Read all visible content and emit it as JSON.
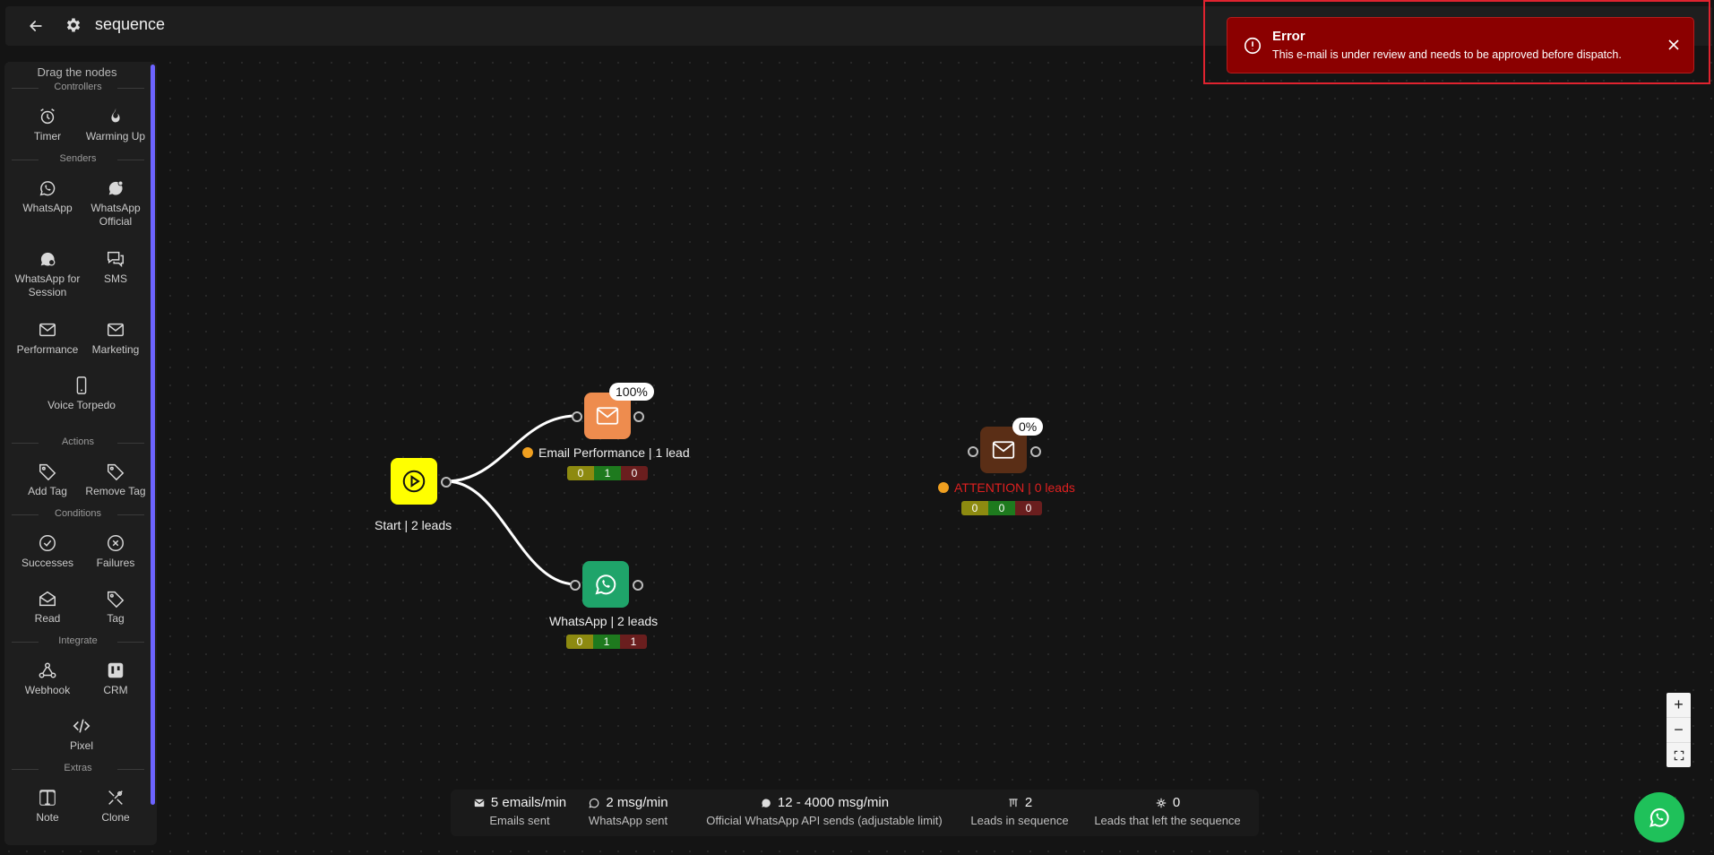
{
  "header": {
    "title": "sequence"
  },
  "sidebar": {
    "hint": "Drag the nodes",
    "sections": {
      "controllers": "Controllers",
      "senders": "Senders",
      "actions": "Actions",
      "conditions": "Conditions",
      "integrate": "Integrate",
      "extras": "Extras"
    },
    "tools": {
      "timer": "Timer",
      "warming_up": "Warming Up",
      "whatsapp": "WhatsApp",
      "whatsapp_official": "WhatsApp Official",
      "whatsapp_session": "WhatsApp for Session",
      "sms": "SMS",
      "performance": "Performance",
      "marketing": "Marketing",
      "voice_torpedo": "Voice Torpedo",
      "add_tag": "Add Tag",
      "remove_tag": "Remove Tag",
      "successes": "Successes",
      "failures": "Failures",
      "read": "Read",
      "tag": "Tag",
      "webhook": "Webhook",
      "crm": "CRM",
      "pixel": "Pixel",
      "note": "Note",
      "clone": "Clone"
    }
  },
  "canvas": {
    "start": {
      "label": "Start | 2 leads",
      "color": "#ffff00"
    },
    "email_performance": {
      "label": "Email Performance | 1 lead",
      "percent": "100%",
      "stats": [
        "0",
        "1",
        "0"
      ],
      "color": "#ee8c4e"
    },
    "whatsapp": {
      "label": "WhatsApp | 2 leads",
      "stats": [
        "0",
        "1",
        "1"
      ],
      "color": "#1fa46a"
    },
    "attention": {
      "label": "ATTENTION | 0 leads",
      "percent": "0%",
      "stats": [
        "0",
        "0",
        "0"
      ],
      "color": "#5a2e16",
      "label_color": "#e02020"
    }
  },
  "toast": {
    "title": "Error",
    "message": "This e-mail is under review and needs to be approved before dispatch.",
    "bg": "#8b0000"
  },
  "zoom": {
    "plus": "+",
    "minus": "−"
  },
  "footer": {
    "emails": {
      "value": "5 emails/min",
      "label": "Emails sent"
    },
    "whatsapp": {
      "value": "2 msg/min",
      "label": "WhatsApp sent"
    },
    "official": {
      "value": "12 - 4000 msg/min",
      "label": "Official WhatsApp API sends (adjustable limit)"
    },
    "leads_in": {
      "value": "2",
      "label": "Leads in sequence"
    },
    "leads_left": {
      "value": "0",
      "label": "Leads that left the sequence"
    }
  }
}
